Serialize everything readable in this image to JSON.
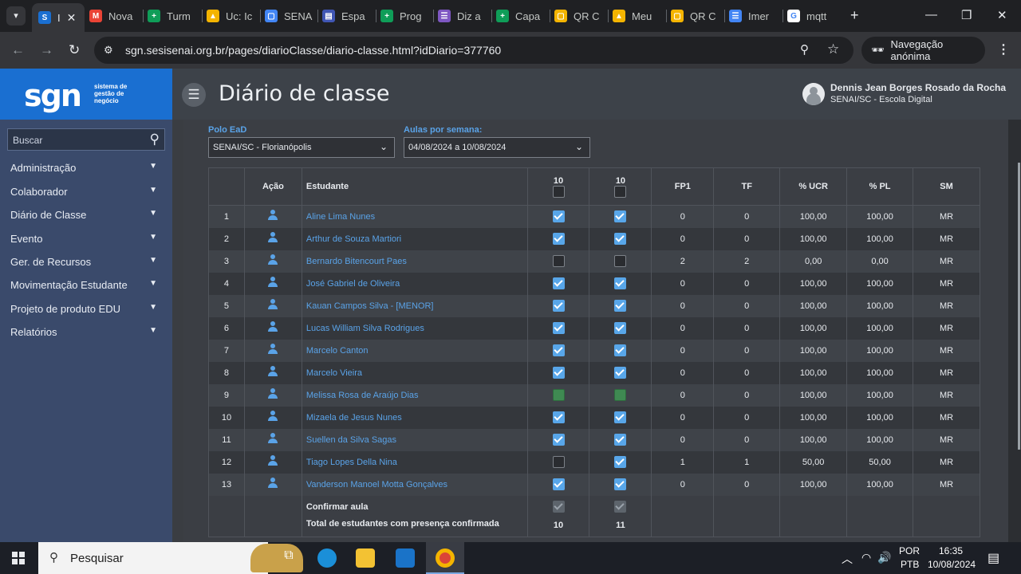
{
  "browser": {
    "tabs": [
      {
        "label": "I",
        "color": "#1a6fd1",
        "glyph": "S",
        "active": true
      },
      {
        "label": "Nova",
        "color": "#ea4335",
        "glyph": "M"
      },
      {
        "label": "Turm",
        "color": "#0f9d58",
        "glyph": "+"
      },
      {
        "label": "Uc: Ic",
        "color": "#f4b400",
        "glyph": "▲"
      },
      {
        "label": "SENA",
        "color": "#4285f4",
        "glyph": "▢"
      },
      {
        "label": "Espa",
        "color": "#4056b4",
        "glyph": "▤"
      },
      {
        "label": "Prog",
        "color": "#0f9d58",
        "glyph": "+"
      },
      {
        "label": "Diz a",
        "color": "#7e57c2",
        "glyph": "☰"
      },
      {
        "label": "Capa",
        "color": "#0f9d58",
        "glyph": "+"
      },
      {
        "label": "QR C",
        "color": "#f4b400",
        "glyph": "▢"
      },
      {
        "label": "Meu",
        "color": "#f4b400",
        "glyph": "▲"
      },
      {
        "label": "QR C",
        "color": "#f4b400",
        "glyph": "▢"
      },
      {
        "label": "Imer",
        "color": "#4285f4",
        "glyph": "☰"
      },
      {
        "label": "mqtt",
        "color": "#ffffff",
        "glyph": "G"
      }
    ],
    "url": "sgn.sesisenai.org.br/pages/diarioClasse/diario-classe.html?idDiario=377760",
    "incognito_label": "Navegação anónima"
  },
  "logo": {
    "text": "sgn",
    "tagline_1": "sistema de",
    "tagline_2": "gestão de",
    "tagline_3": "negócio"
  },
  "sidebar": {
    "search_placeholder": "Buscar",
    "items": [
      "Administração",
      "Colaborador",
      "Diário de Classe",
      "Evento",
      "Ger. de Recursos",
      "Movimentação Estudante",
      "Projeto de produto EDU",
      "Relatórios"
    ]
  },
  "header": {
    "title": "Diário de classe",
    "user_name": "Dennis Jean Borges Rosado da Rocha",
    "user_org": "SENAI/SC - Escola Digital"
  },
  "filters": {
    "polo_label": "Polo EaD",
    "polo_value": "SENAI/SC - Florianópolis",
    "aulas_label": "Aulas por semana:",
    "aulas_value": "04/08/2024 a 10/08/2024"
  },
  "table": {
    "headers": {
      "acao": "Ação",
      "estudante": "Estudante",
      "aula1": "10",
      "aula2": "10",
      "fp1": "FP1",
      "tf": "TF",
      "ucr": "% UCR",
      "pl": "% PL",
      "sm": "SM"
    },
    "rows": [
      {
        "n": "1",
        "name": "Aline Lima Nunes",
        "a1": "on",
        "a2": "on",
        "fp1": "0",
        "tf": "0",
        "ucr": "100,00",
        "pl": "100,00",
        "sm": "MR"
      },
      {
        "n": "2",
        "name": "Arthur de Souza Martiori",
        "a1": "on",
        "a2": "on",
        "fp1": "0",
        "tf": "0",
        "ucr": "100,00",
        "pl": "100,00",
        "sm": "MR"
      },
      {
        "n": "3",
        "name": "Bernardo Bitencourt Paes",
        "a1": "off",
        "a2": "off",
        "fp1": "2",
        "tf": "2",
        "ucr": "0,00",
        "pl": "0,00",
        "sm": "MR"
      },
      {
        "n": "4",
        "name": "José Gabriel de Oliveira",
        "a1": "on",
        "a2": "on",
        "fp1": "0",
        "tf": "0",
        "ucr": "100,00",
        "pl": "100,00",
        "sm": "MR"
      },
      {
        "n": "5",
        "name": "Kauan Campos Silva - [MENOR]",
        "a1": "on",
        "a2": "on",
        "fp1": "0",
        "tf": "0",
        "ucr": "100,00",
        "pl": "100,00",
        "sm": "MR"
      },
      {
        "n": "6",
        "name": "Lucas William Silva Rodrigues",
        "a1": "on",
        "a2": "on",
        "fp1": "0",
        "tf": "0",
        "ucr": "100,00",
        "pl": "100,00",
        "sm": "MR"
      },
      {
        "n": "7",
        "name": "Marcelo Canton",
        "a1": "on",
        "a2": "on",
        "fp1": "0",
        "tf": "0",
        "ucr": "100,00",
        "pl": "100,00",
        "sm": "MR"
      },
      {
        "n": "8",
        "name": "Marcelo Vieira",
        "a1": "on",
        "a2": "on",
        "fp1": "0",
        "tf": "0",
        "ucr": "100,00",
        "pl": "100,00",
        "sm": "MR"
      },
      {
        "n": "9",
        "name": "Melissa Rosa de Araújo Dias",
        "a1": "green",
        "a2": "green",
        "fp1": "0",
        "tf": "0",
        "ucr": "100,00",
        "pl": "100,00",
        "sm": "MR"
      },
      {
        "n": "10",
        "name": "Mizaela de Jesus Nunes",
        "a1": "on",
        "a2": "on",
        "fp1": "0",
        "tf": "0",
        "ucr": "100,00",
        "pl": "100,00",
        "sm": "MR"
      },
      {
        "n": "11",
        "name": "Suellen da Silva Sagas",
        "a1": "on",
        "a2": "on",
        "fp1": "0",
        "tf": "0",
        "ucr": "100,00",
        "pl": "100,00",
        "sm": "MR"
      },
      {
        "n": "12",
        "name": "Tiago Lopes Della Nina",
        "a1": "off",
        "a2": "on",
        "fp1": "1",
        "tf": "1",
        "ucr": "50,00",
        "pl": "50,00",
        "sm": "MR"
      },
      {
        "n": "13",
        "name": "Vanderson Manoel Motta Gonçalves",
        "a1": "on",
        "a2": "on",
        "fp1": "0",
        "tf": "0",
        "ucr": "100,00",
        "pl": "100,00",
        "sm": "MR"
      }
    ],
    "footer": {
      "confirm_label": "Confirmar aula",
      "total_label": "Total de estudantes com presença confirmada",
      "total_1": "10",
      "total_2": "11"
    }
  },
  "taskbar": {
    "search_placeholder": "Pesquisar",
    "lang": "POR",
    "layout": "PTB",
    "time": "16:35",
    "date": "10/08/2024"
  }
}
